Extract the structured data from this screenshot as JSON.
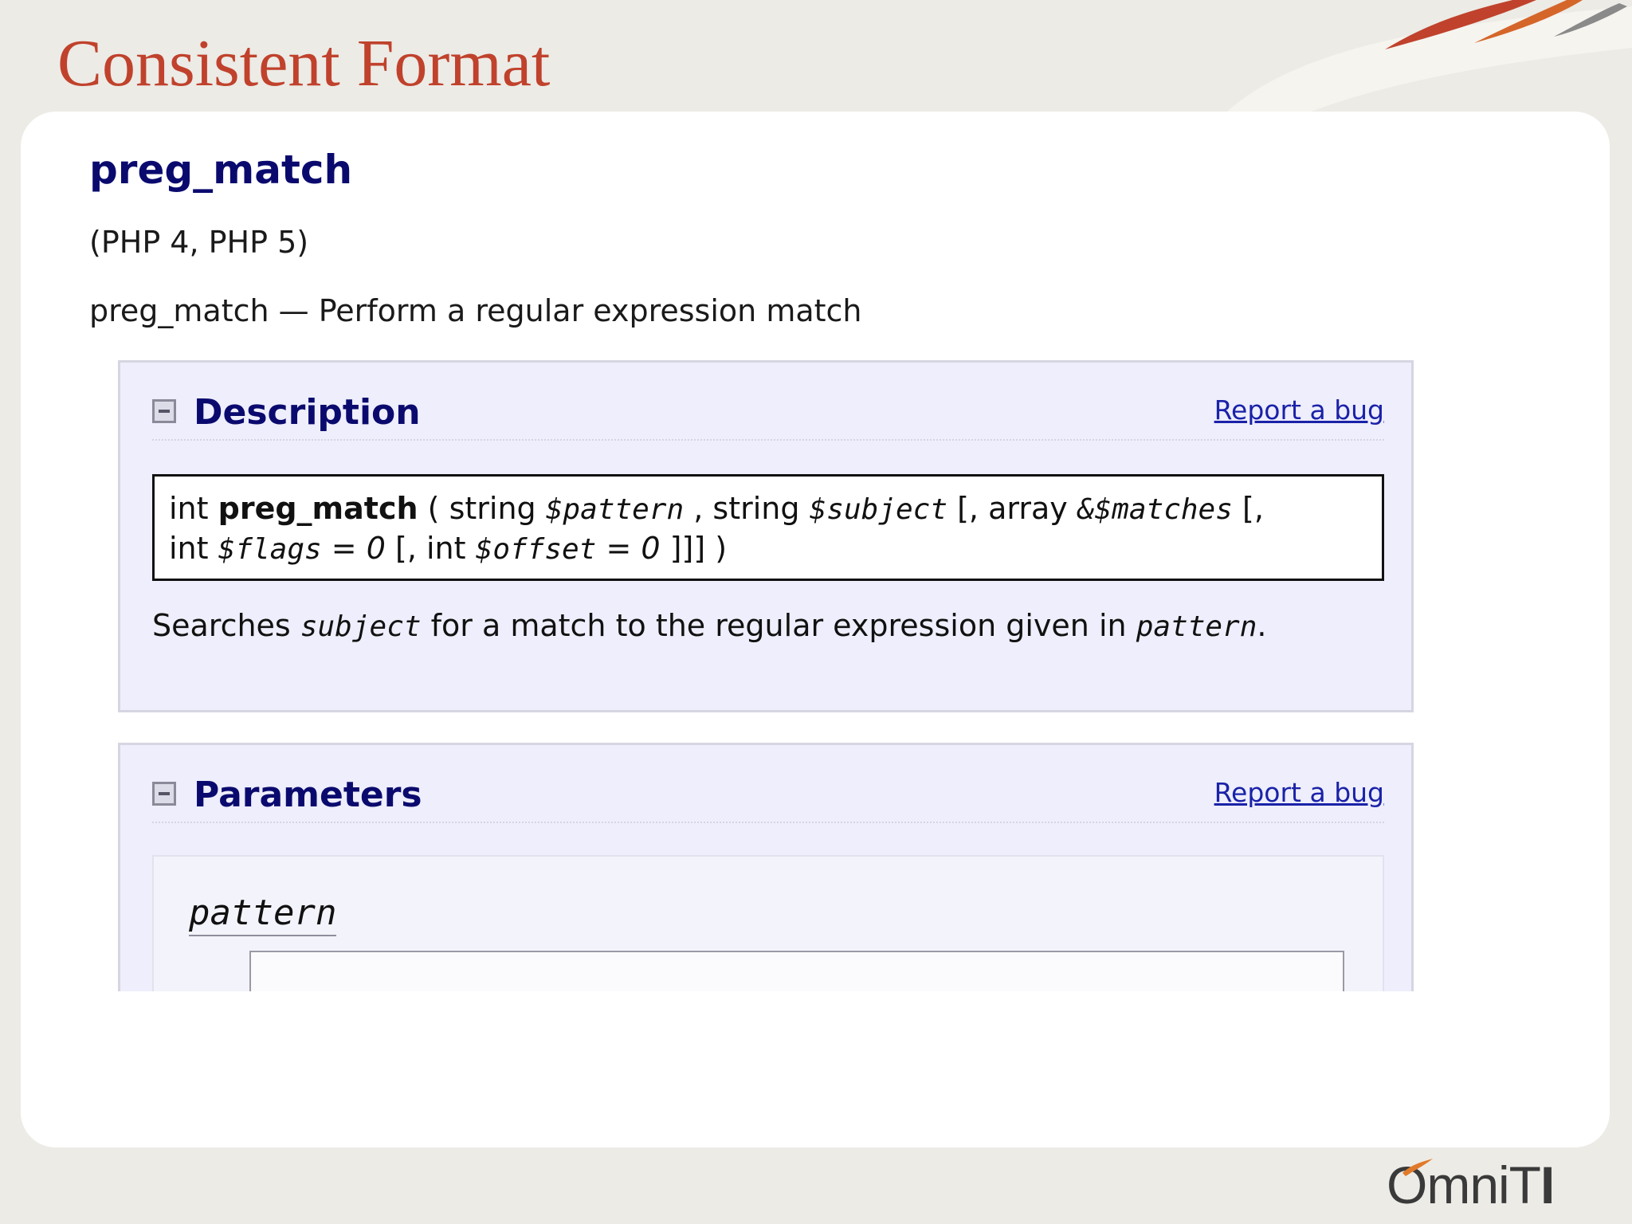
{
  "slide": {
    "title": "Consistent Format",
    "logo_text_light": "OmniT",
    "logo_text_bold": "I"
  },
  "doc": {
    "refname": "preg_match",
    "version": "(PHP 4, PHP 5)",
    "refpurpose": "preg_match — Perform a regular expression match",
    "description": {
      "title": "Description",
      "report_bug": "Report a bug",
      "synopsis": {
        "return_type": "int",
        "function_name": "preg_match",
        "open_paren": "(",
        "p1_type": "string",
        "p1_name": "$pattern",
        "sep1": ",",
        "p2_type": "string",
        "p2_name": "$subject",
        "opt_open1": "[,",
        "p3_type": "array",
        "p3_name": "&$matches",
        "opt_open2": "[,",
        "p4_type": "int",
        "p4_name": "$flags",
        "equals": "=",
        "p4_default": "0",
        "opt_open3": "[,",
        "p5_type": "int",
        "p5_name": "$offset",
        "p5_default": "0",
        "closing": "]]] )"
      },
      "text": {
        "before": "Searches",
        "param1": "subject",
        "middle": "for a match to the regular expression given in",
        "param2": "pattern",
        "after": "."
      }
    },
    "parameters": {
      "title": "Parameters",
      "report_bug": "Report a bug",
      "first_param": "pattern"
    }
  },
  "colors": {
    "title_red": "#c0422c",
    "heading_navy": "#0a0a6e",
    "link_blue": "#1a22a8",
    "section_bg": "#eeeefc",
    "slide_bg": "#ecebe6",
    "swoosh_red": "#c0422c",
    "swoosh_orange": "#e07a2a"
  },
  "icons": {
    "collapse": "collapse-minus-icon",
    "swoosh": "flame-swoosh-decoration",
    "logo": "omniti-logo"
  }
}
